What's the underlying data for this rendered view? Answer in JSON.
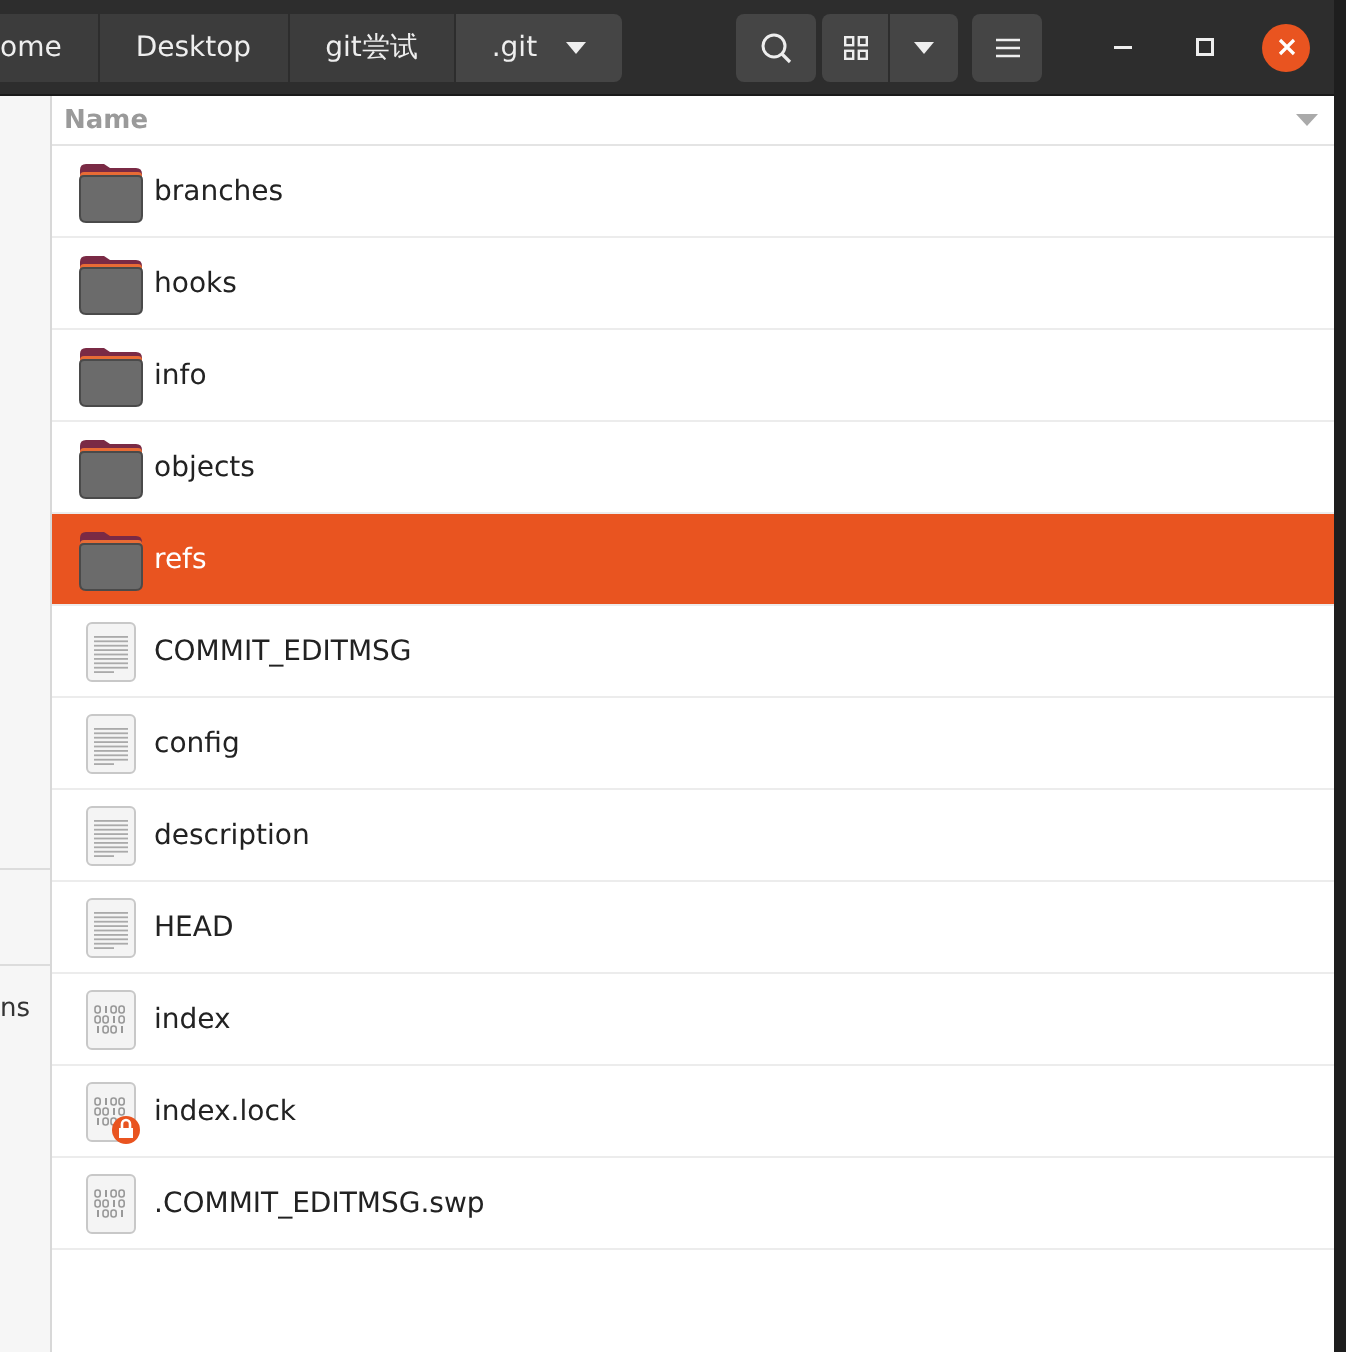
{
  "toolbar": {
    "breadcrumbs": [
      {
        "label": "ome",
        "selected": false
      },
      {
        "label": "Desktop",
        "selected": false
      },
      {
        "label": "git尝试",
        "selected": false
      },
      {
        "label": ".git",
        "selected": true
      }
    ]
  },
  "sidebar": {
    "items": [
      {
        "label": "ns"
      }
    ]
  },
  "file_list": {
    "columns": [
      {
        "label": "Name"
      }
    ],
    "rows": [
      {
        "name": "branches",
        "kind": "folder",
        "selected": false,
        "locked": false
      },
      {
        "name": "hooks",
        "kind": "folder",
        "selected": false,
        "locked": false
      },
      {
        "name": "info",
        "kind": "folder",
        "selected": false,
        "locked": false
      },
      {
        "name": "objects",
        "kind": "folder",
        "selected": false,
        "locked": false
      },
      {
        "name": "refs",
        "kind": "folder",
        "selected": true,
        "locked": false
      },
      {
        "name": "COMMIT_EDITMSG",
        "kind": "text",
        "selected": false,
        "locked": false
      },
      {
        "name": "config",
        "kind": "text",
        "selected": false,
        "locked": false
      },
      {
        "name": "description",
        "kind": "text",
        "selected": false,
        "locked": false
      },
      {
        "name": "HEAD",
        "kind": "text",
        "selected": false,
        "locked": false
      },
      {
        "name": "index",
        "kind": "binary",
        "selected": false,
        "locked": false
      },
      {
        "name": "index.lock",
        "kind": "binary",
        "selected": false,
        "locked": true
      },
      {
        "name": ".COMMIT_EDITMSG.swp",
        "kind": "binary",
        "selected": false,
        "locked": false
      }
    ]
  }
}
